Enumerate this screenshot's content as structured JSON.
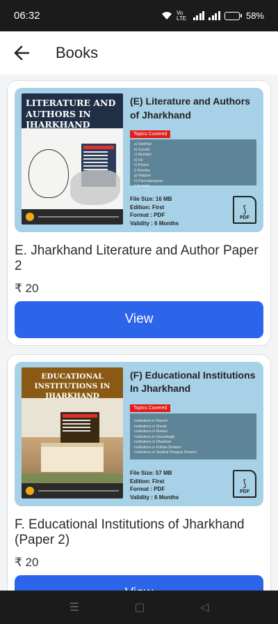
{
  "status": {
    "time": "06:32",
    "network": "Vo LTE",
    "battery": "58%",
    "battery_level": 0.58
  },
  "header": {
    "title": "Books"
  },
  "books": [
    {
      "cover_title": "LITERATURE AND AUTHORS IN JHARKHAND",
      "banner_title": "(E) Literature and Authors of Jharkhand",
      "topics_label": "Topics Covered",
      "topics": [
        "a) Santhali",
        "b) Kurukh",
        "c) Mundari",
        "d) Ho",
        "e) Kharia",
        "f) Khortha",
        "g) Nagpuri",
        "h) Panchpargania",
        "i) Kurmali"
      ],
      "file_size": "File Size: 16 MB",
      "edition": "Edition: First",
      "format": "Format : PDF",
      "validity": "Validity : 6 Months",
      "pdf_label": "PDF",
      "name": "E. Jharkhand Literature and Author Paper 2",
      "price": "₹ 20",
      "button": "View"
    },
    {
      "cover_title": "EDUCATIONAL INSTITUTIONS IN JHARKHAND",
      "banner_title": "(F) Educational Institutions In Jharkhand",
      "topics_label": "Topics Covered",
      "topics": [
        "Institutions in Ranchi",
        "Institutions in Khunti",
        "Institutions in Bokaro",
        "Institutions in Hazaribagh",
        "Institutions in Dhanbad",
        "Institutions in Kolhan Division",
        "Institutions in Santhal Pargana Division"
      ],
      "file_size": "File Size: 57 MB",
      "edition": "Edition: First",
      "format": "Format : PDF",
      "validity": "Validity : 6 Months",
      "pdf_label": "PDF",
      "name": "F. Educational Institutions of Jharkhand (Paper 2)",
      "price": "₹ 20",
      "button": "View"
    }
  ],
  "nav": {
    "recent": "☰",
    "home": "▢",
    "back": "◁"
  }
}
